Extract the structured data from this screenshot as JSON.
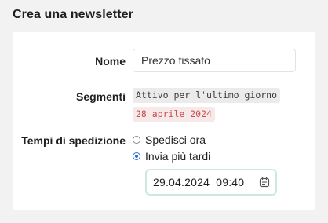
{
  "page": {
    "title": "Crea una newsletter"
  },
  "form": {
    "name_label": "Nome",
    "name_value": "Prezzo fissato",
    "segments_label": "Segmenti",
    "segment_tag": "Attivo per l'ultimo giorno",
    "segment_date": "28 aprile 2024",
    "send_time_label": "Tempi di spedizione",
    "options": [
      {
        "label": "Spedisci ora",
        "checked": false
      },
      {
        "label": "Invia più tardi",
        "checked": true
      }
    ],
    "datetime_value": "29.04.2024  09:40",
    "datetime_icon": "calendar-icon"
  },
  "colors": {
    "accent": "#2a6fd6",
    "date_tag_text": "#cf4a4a",
    "date_tag_bg": "#f5e9e9",
    "datetime_border": "#cfe8df"
  }
}
